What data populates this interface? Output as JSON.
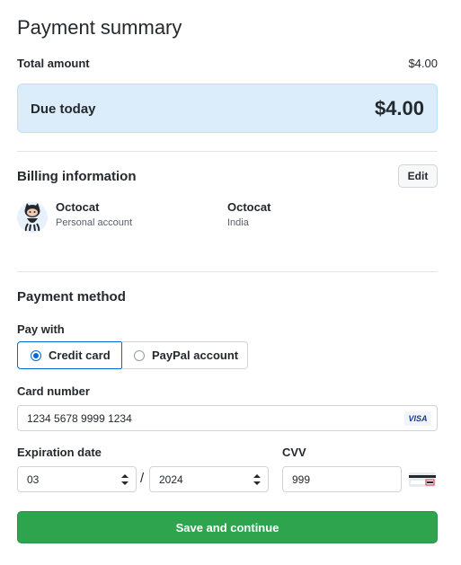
{
  "page": {
    "title": "Payment summary"
  },
  "summary": {
    "total_label": "Total amount",
    "total_value": "$4.00",
    "due_label": "Due today",
    "due_value": "$4.00"
  },
  "billing": {
    "title": "Billing information",
    "edit_label": "Edit",
    "account_name": "Octocat",
    "account_type": "Personal account",
    "billing_name": "Octocat",
    "billing_country": "India"
  },
  "payment": {
    "title": "Payment method",
    "pay_with_label": "Pay with",
    "options": [
      {
        "label": "Credit card",
        "selected": true
      },
      {
        "label": "PayPal account",
        "selected": false
      }
    ],
    "card_number_label": "Card number",
    "card_number_value": "1234 5678 9999 1234",
    "card_brand": "VISA",
    "expiration_label": "Expiration date",
    "exp_month": "03",
    "exp_separator": "/",
    "exp_year": "2024",
    "cvv_label": "CVV",
    "cvv_value": "999"
  },
  "actions": {
    "save_label": "Save and continue"
  },
  "colors": {
    "accent_blue": "#0366d6",
    "primary_green": "#2ea44f",
    "due_bg": "#dbedfb"
  },
  "icons": {
    "avatar": "octocat-avatar",
    "card_brand": "visa-icon",
    "cvv": "card-back-icon"
  }
}
